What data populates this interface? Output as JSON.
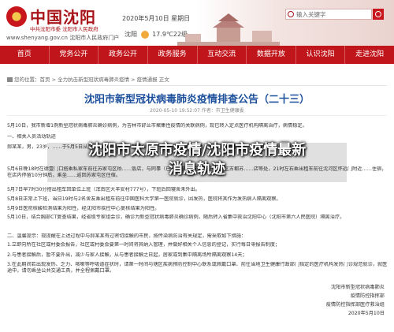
{
  "header": {
    "site_title": "中国沈阳",
    "site_sub": "中共沈阳市委  沈阳市人民政府",
    "site_url": "www.shenyang.gov.cn",
    "site_url_tail": "沈阳市人民政府门户",
    "date": "2020年5月10日 星期日",
    "city": "沈阳",
    "temperature": "17.9℃22级",
    "search_placeholder": "输入关键字"
  },
  "nav": {
    "items": [
      "首页",
      "党务公开",
      "政务公开",
      "政务服务",
      "互动交流",
      "数据开放",
      "认识沈阳",
      "走进沈阳"
    ]
  },
  "breadcrumb": "您的位置：首页 > 全力抗击新型冠状病毒肺炎疫情 > 疫情通报 正文",
  "article": {
    "title": "沈阳市新型冠状病毒肺炎疫情排查公告（二十三）",
    "meta": "2020-05-10 19:52:07          作者：市卫生健康委",
    "lines": [
      "5月10日，我市新增1例新型冠状病毒肺炎确诊病例，为吉林市舒兰市聚集性疫情的关联病例，现已转入定点医疗机构隔离治疗，病情稳定。",
      "一、相关人员活动轨迹",
      "郝某某，男，23岁，……于5月5日从舒兰出发，乘坐……列车G8024于20时到达沈阳南站，与共事场所等……",
      "5月6日晚18时在德壹门口搭乘私家车前往苏家屯区杨……饭店，与同事（已隔离观察）在沈阳市于洪区古都苏……店等处，21时左右乘出租车前往沈河区怀远门附近……住宿，在店内停留10分钟后，乘坐……返回苏家屯区住宿。",
      "5月7日早7时30分搭出租车回单位上班（浑南区大羊安村777号），下班后回寝舍未外出。",
      "5月8日正常上下班，当日19时与2名舍友乘出租车前往中国医科大学第一医院就诊，因发热，医院将其作为发热病人隔离观察。",
      "5月9日医院核酸检测结果为阳性，经沈阳市疾控中心复核结果为阳性。",
      "5月10日，结合胸部CT复查结果，经省级专家组会诊，确诊为新型冠状病毒肺炎确诊病例，随后转入省集中救治沈阳中心（沈阳市第六人民医院）隔离治疗。",
      "二、温馨提示：现提醒在上述过程中与郝某某有过密切接触的市民，按传染病防治有关规定，需采取如下措施：",
      "1.立即向所在社区或村委会报告，社区或村委会要第一时间将其纳入管理，并做好相关个人信息的登记，实行每日零报告制度；",
      "2.与患者接触后，暂不要外出，减少与家人接触，从与患者接触之日起，居家或到集中隔离场所隔离观察14天；",
      "3.在此期间若出现发热、乏力、咳嗽等呼吸道症状时，请第一时间与辖区疾病预防控制中心联系或佩戴口罩、前往当地卫生健康行政部门指定的医疗机构发热门诊规范就诊，就医途中，请勿乘坐公共交通工具，并全程佩戴口罩。"
    ],
    "signature": [
      "沈阳市新型冠状病毒肺炎",
      "疫情防控指挥部",
      "疫情防控指挥部医疗救治组",
      "2020年5月10日"
    ]
  },
  "overlay": {
    "line1": "沈阳市太原市疫情/沈阳市疫情最新",
    "line2": "消息轨迹"
  }
}
